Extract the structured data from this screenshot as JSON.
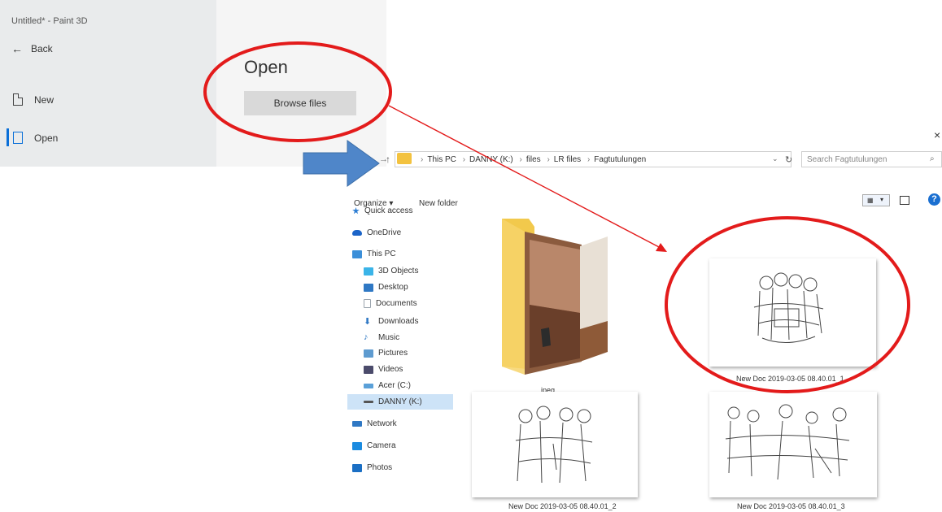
{
  "paint": {
    "window_title": "Untitled* - Paint 3D",
    "back_label": "Back",
    "menu": [
      {
        "label": "New"
      },
      {
        "label": "Open"
      }
    ],
    "open_heading": "Open",
    "browse_label": "Browse files"
  },
  "explorer": {
    "close_glyph": "×",
    "breadcrumb": [
      "This PC",
      "DANNY (K:)",
      "files",
      "LR files",
      "Fagtutulungen"
    ],
    "search_placeholder": "Search Fagtutulungen",
    "toolbar": {
      "organize": "Organize ▾",
      "new_folder": "New folder"
    },
    "nav": [
      {
        "label": "Quick access",
        "icon": "star-icon",
        "color": "#2b7cd3"
      },
      {
        "label": "OneDrive",
        "icon": "cloud-icon",
        "color": "#1c64c8"
      },
      {
        "label": "This PC",
        "icon": "pc-icon",
        "color": "#3b8fd9"
      },
      {
        "label": "3D Objects",
        "icon": "cube-icon",
        "color": "#3ab4e8"
      },
      {
        "label": "Desktop",
        "icon": "desktop-icon",
        "color": "#2f78c4"
      },
      {
        "label": "Documents",
        "icon": "documents-icon",
        "color": "#9aa4ad"
      },
      {
        "label": "Downloads",
        "icon": "download-icon",
        "color": "#2f78c4"
      },
      {
        "label": "Music",
        "icon": "music-icon",
        "color": "#2f78c4"
      },
      {
        "label": "Pictures",
        "icon": "pictures-icon",
        "color": "#5e9bd0"
      },
      {
        "label": "Videos",
        "icon": "videos-icon",
        "color": "#4b4b6b"
      },
      {
        "label": "Acer (C:)",
        "icon": "drive-icon",
        "color": "#5aa0d8"
      },
      {
        "label": "DANNY (K:)",
        "icon": "usb-drive-icon",
        "color": "#555555"
      },
      {
        "label": "Network",
        "icon": "network-icon",
        "color": "#2f78c4"
      },
      {
        "label": "Camera",
        "icon": "camera-icon",
        "color": "#1b8be0"
      },
      {
        "label": "Photos",
        "icon": "photos-icon",
        "color": "#1b6fc4"
      }
    ],
    "items": [
      {
        "name": "jpeg"
      },
      {
        "name": "New Doc 2019-03-05 08.40.01_1"
      },
      {
        "name": "New Doc 2019-03-05 08.40.01_2"
      },
      {
        "name": "New Doc 2019-03-05 08.40.01_3"
      }
    ]
  },
  "colors": {
    "annotation_red": "#e31b1b",
    "arrow_blue": "#4f86c9",
    "accent": "#0a6fd8"
  }
}
